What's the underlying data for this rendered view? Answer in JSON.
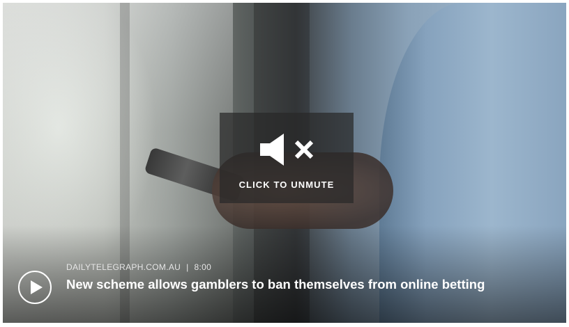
{
  "overlay": {
    "unmute_label": "CLICK TO UNMUTE",
    "icon": "speaker-muted-icon"
  },
  "video": {
    "source": "DAILYTELEGRAPH.COM.AU",
    "separator": "|",
    "duration": "8:00",
    "title": "New scheme allows gamblers to ban themselves from online betting"
  },
  "controls": {
    "play_icon": "play-icon"
  },
  "colors": {
    "overlay_bg": "#282828",
    "text": "#ffffff"
  }
}
